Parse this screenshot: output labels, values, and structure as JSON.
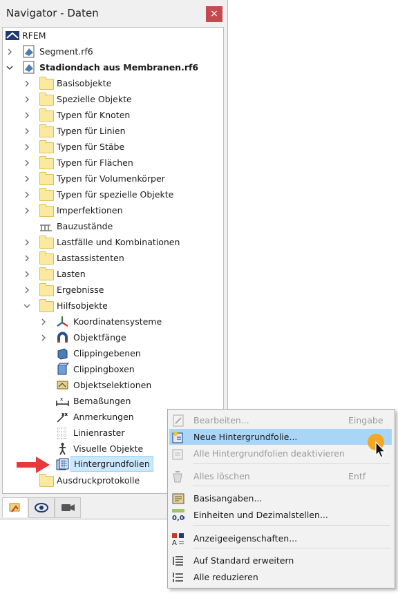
{
  "window": {
    "title": "Navigator - Daten",
    "close_glyph": "×"
  },
  "tree": {
    "root": "RFEM",
    "files": [
      {
        "label": "Segment.rf6"
      },
      {
        "label": "Stadiondach aus Membranen.rf6"
      }
    ],
    "categories": [
      "Basisobjekte",
      "Spezielle Objekte",
      "Typen für Knoten",
      "Typen für Linien",
      "Typen für Stäbe",
      "Typen für Flächen",
      "Typen für Volumenkörper",
      "Typen für spezielle Objekte",
      "Imperfektionen",
      "Bauzustände",
      "Lastfälle und Kombinationen",
      "Lastassistenten",
      "Lasten",
      "Ergebnisse",
      "Hilfsobjekte"
    ],
    "hilfsobjekte": [
      "Koordinatensysteme",
      "Objektfänge",
      "Clippingebenen",
      "Clippingboxen",
      "Objektselektionen",
      "Bemaßungen",
      "Anmerkungen",
      "Linienraster",
      "Visuelle Objekte",
      "Hintergrundfolien"
    ],
    "last": "Ausdruckprotokolle"
  },
  "context_menu": {
    "items": [
      {
        "label": "Bearbeiten...",
        "shortcut": "Eingabe",
        "disabled": true
      },
      {
        "label": "Neue Hintergrundfolie...",
        "shortcut": "",
        "highlighted": true
      },
      {
        "label": "Alle Hintergrundfolien deaktivieren",
        "shortcut": "",
        "disabled": true
      },
      {
        "label": "Alles löschen",
        "shortcut": "Entf",
        "disabled": true
      },
      {
        "label": "Basisangaben...",
        "shortcut": ""
      },
      {
        "label": "Einheiten und Dezimalstellen...",
        "shortcut": ""
      },
      {
        "label": "Anzeigeeigenschaften...",
        "shortcut": ""
      },
      {
        "label": "Auf Standard erweitern",
        "shortcut": ""
      },
      {
        "label": "Alle reduzieren",
        "shortcut": ""
      }
    ],
    "units_icon_text": "0,00"
  },
  "colors": {
    "accent_selection": "#cce8ff",
    "menu_highlight": "#a9d6f7",
    "arrow": "#e8383c",
    "cursor_dot": "#f5a623"
  }
}
